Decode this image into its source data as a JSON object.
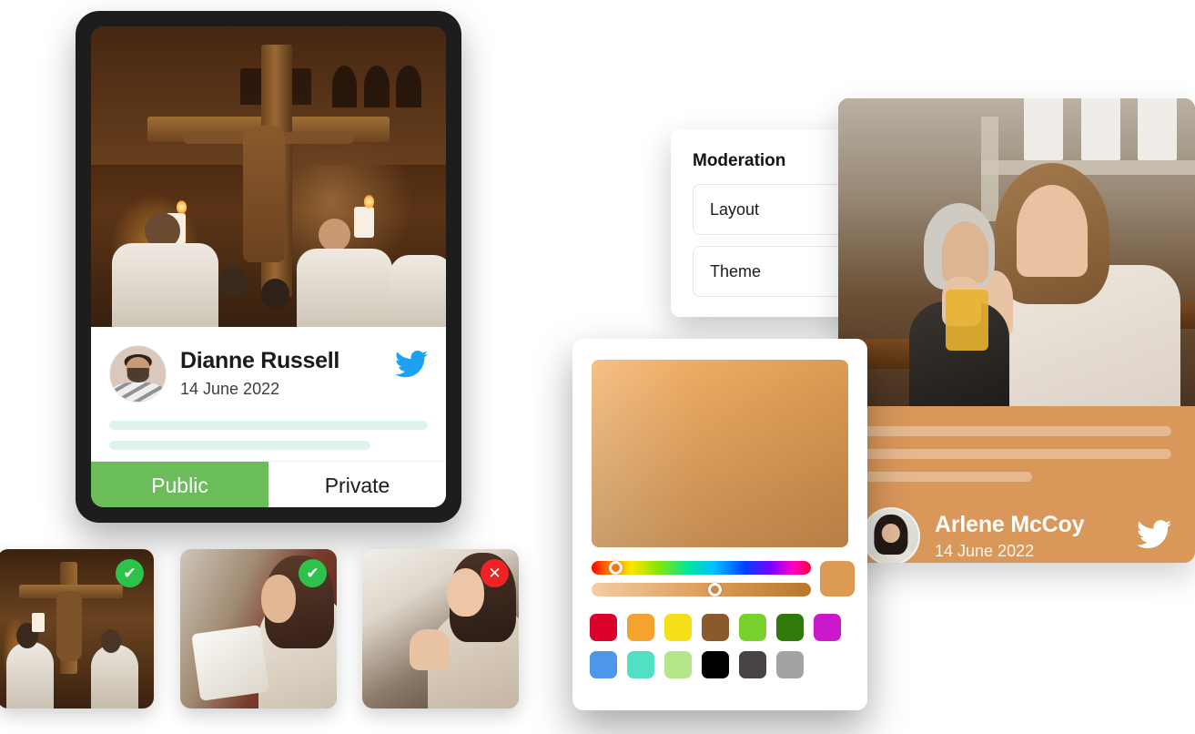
{
  "post_card": {
    "photo_alt": "religious-procession-photo",
    "user_name": "Dianne Russell",
    "date": "14 June 2022",
    "social_icon": "twitter-icon",
    "social_color": "#1da1f2",
    "skeleton_lines": 2,
    "segments": [
      {
        "label": "Public",
        "active": true,
        "color": "#6bbd5b"
      },
      {
        "label": "Private",
        "active": false,
        "color": "#ffffff"
      }
    ],
    "frame_color": "#1d1d1d"
  },
  "moderation": {
    "title": "Moderation",
    "rows": [
      {
        "label": "Layout",
        "has_toggle": true,
        "toggle_on": true
      },
      {
        "label": "Theme",
        "has_toggle": false,
        "toggle_on": false
      }
    ],
    "toggle_color": "#f0a132"
  },
  "arlene_card": {
    "photo_alt": "women-praying-in-church-photo",
    "user_name": "Arlene McCoy",
    "date": "14 June 2022",
    "social_icon": "twitter-icon",
    "background_color": "#d9975a",
    "skeleton_lines": 3
  },
  "color_picker": {
    "selected_color": "#dc9a52",
    "hue_position_pct": 8,
    "alpha_position_pct": 55,
    "swatch_rows": [
      [
        "#d9002b",
        "#f5a22e",
        "#f5e018",
        "#8b5a2b",
        "#78d22b",
        "#2f7a0b",
        "#cc18cc"
      ],
      [
        "#4d96ea",
        "#52e0c4",
        "#b6e68a",
        "#000000",
        "#474443",
        "#a3a3a3"
      ]
    ]
  },
  "thumbnails": [
    {
      "alt": "procession-thumbnail",
      "status": "approved",
      "badge_icon": "check-icon",
      "badge_color": "#2fc24a",
      "badge_glyph": "✔"
    },
    {
      "alt": "woman-reading-bible-thumbnail",
      "status": "approved",
      "badge_icon": "check-icon",
      "badge_color": "#2fc24a",
      "badge_glyph": "✔"
    },
    {
      "alt": "woman-praying-thumbnail",
      "status": "rejected",
      "badge_icon": "close-icon",
      "badge_color": "#ee2424",
      "badge_glyph": "✕"
    }
  ]
}
